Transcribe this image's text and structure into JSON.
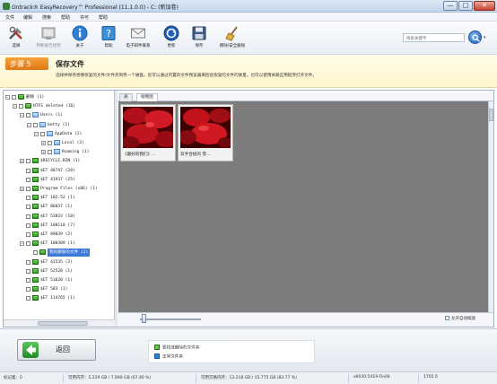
{
  "window": {
    "title": "Ontrack® EasyRecovery™ Professional (11.1.0.0) - C: (新加卷)",
    "min_label": "—",
    "max_label": "□",
    "close_label": "✕"
  },
  "menu": [
    "文件",
    "编辑",
    "搜索",
    "帮助",
    "许可",
    "帮助"
  ],
  "toolbar": {
    "buttons": [
      {
        "label": "选择",
        "icon": "tools-icon",
        "enabled": true
      },
      {
        "label": "判断报告找到",
        "icon": "report-icon",
        "enabled": false
      },
      {
        "label": "关于",
        "icon": "info-icon",
        "enabled": true
      },
      {
        "label": "帮助",
        "icon": "help-icon",
        "enabled": true
      },
      {
        "label": "电子邮件联系",
        "icon": "mail-icon",
        "enabled": true
      },
      {
        "label": "更新",
        "icon": "update-icon",
        "enabled": true
      },
      {
        "label": "保存",
        "icon": "save-icon",
        "enabled": true
      },
      {
        "label": "擦除/安全删除",
        "icon": "broom-icon",
        "enabled": true
      }
    ],
    "search_placeholder": "搜索关键字",
    "search_dropdown": "▾"
  },
  "step": {
    "badge": "步骤 5",
    "title": "保存文件",
    "description": "选择并保存想要恢复的文件/文件夹到另一个磁盘，您可以通过内置的文件预览器来检验恢复的文件的质量，也可以使用关联应用程序打开文件。"
  },
  "tree": [
    {
      "label": "删除 (1)",
      "level": 0,
      "expander": "−",
      "icon": "drive"
    },
    {
      "label": "NTFS deleted (16)",
      "level": 1,
      "expander": "−",
      "icon": "drive"
    },
    {
      "label": "Users (1)",
      "level": 2,
      "expander": "−",
      "icon": "folder"
    },
    {
      "label": "betty (1)",
      "level": 3,
      "expander": "−",
      "icon": "folder"
    },
    {
      "label": "AppData (2)",
      "level": 4,
      "expander": "−",
      "icon": "folder"
    },
    {
      "label": "Local (2)",
      "level": 5,
      "expander": "+",
      "icon": "folder"
    },
    {
      "label": "Roaming (1)",
      "level": 5,
      "expander": "+",
      "icon": "folder"
    },
    {
      "label": "$RECYCLE.BIN (1)",
      "level": 2,
      "expander": "+",
      "icon": "green"
    },
    {
      "label": "$ET 48747 (28)",
      "level": 2,
      "expander": "",
      "icon": "green"
    },
    {
      "label": "$ET 41937 (25)",
      "level": 2,
      "expander": "",
      "icon": "green"
    },
    {
      "label": "Program Files (x86) (1)",
      "level": 2,
      "expander": "+",
      "icon": "green"
    },
    {
      "label": "$ET 102.52 (1)",
      "level": 2,
      "expander": "",
      "icon": "green"
    },
    {
      "label": "$ET 86037 (1)",
      "level": 2,
      "expander": "",
      "icon": "green"
    },
    {
      "label": "$ET 53833 (10)",
      "level": 2,
      "expander": "",
      "icon": "green"
    },
    {
      "label": "$ET 108110 (7)",
      "level": 2,
      "expander": "",
      "icon": "green"
    },
    {
      "label": "$ET 89039 (2)",
      "level": 2,
      "expander": "",
      "icon": "green"
    },
    {
      "label": "$ET 100309 (1)",
      "level": 2,
      "expander": "−",
      "icon": "green"
    },
    {
      "label": "我的删除的文件 (2)",
      "level": 3,
      "expander": "",
      "icon": "green",
      "selected": true
    },
    {
      "label": "$ET 41535 (3)",
      "level": 2,
      "expander": "",
      "icon": "green"
    },
    {
      "label": "$ET 52520 (1)",
      "level": 2,
      "expander": "",
      "icon": "green"
    },
    {
      "label": "$ET 51620 (1)",
      "level": 2,
      "expander": "",
      "icon": "green"
    },
    {
      "label": "$ET 583 (1)",
      "level": 2,
      "expander": "",
      "icon": "green"
    },
    {
      "label": "$ET 114765 (1)",
      "level": 2,
      "expander": "",
      "icon": "green"
    }
  ],
  "tabs": [
    "表",
    "缩略图"
  ],
  "active_tab": 1,
  "thumbnails": [
    {
      "caption": "《最好的我们》..."
    },
    {
      "caption": "双手合拢的 雪..."
    }
  ],
  "autoscale_label": "允许自动缩放",
  "footer": {
    "back_label": "返回",
    "legend": [
      {
        "label": "要找或删除的文件夹",
        "color": "#6cc64e"
      },
      {
        "label": "正常文件夹",
        "color": "#2f7fd6"
      }
    ]
  },
  "status": {
    "marked": "标记着：0",
    "available_space": "可用内存：5.229 GB / 7.890 GB (67.40 %)",
    "available_swap": "可用交换内存：13.218 GB / 15.775 GB (83.77 %)",
    "code": "x6030:5419-Fin04",
    "count": "1705  0"
  },
  "colors": {
    "accent_orange": "#e07712",
    "selection_blue": "#3d7ad8",
    "deleted_green": "#3a9a2a"
  }
}
